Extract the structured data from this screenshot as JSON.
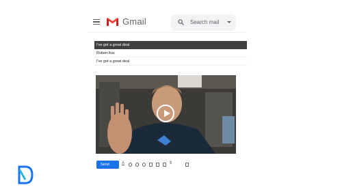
{
  "app": {
    "name": "Gmail"
  },
  "search": {
    "placeholder": "Search mail"
  },
  "compose": {
    "subject": "I've got a great deal",
    "to": "Ruben Itus",
    "body_line": "I've got a great deal"
  },
  "toolbar": {
    "send_label": "Send",
    "formatting_glyph": "A"
  },
  "colors": {
    "brand_red": "#ea4335",
    "send_blue": "#1a73e8"
  }
}
